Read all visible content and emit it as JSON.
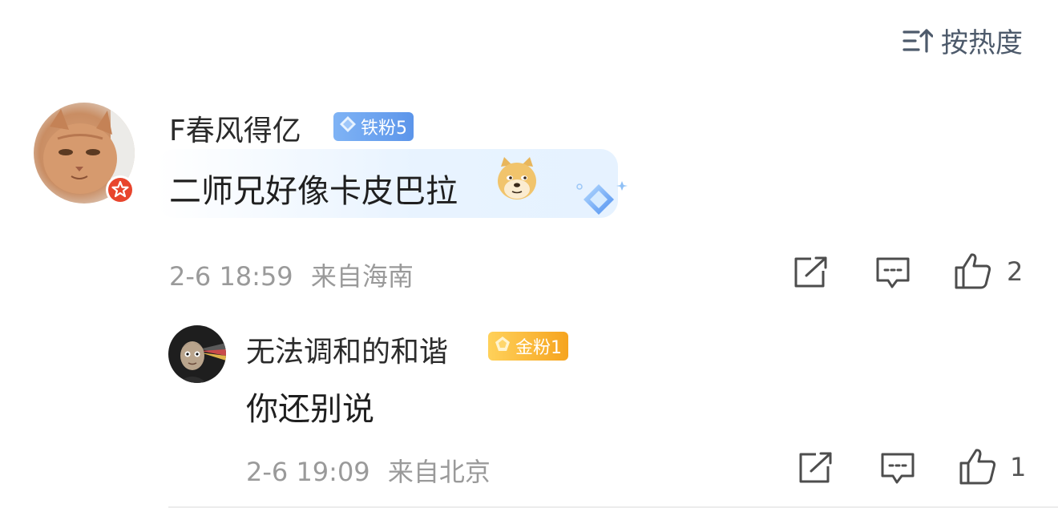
{
  "sort": {
    "label": "按热度",
    "icon": "sort-icon"
  },
  "comment": {
    "username": "F春风得亿",
    "fan_badge": "铁粉5",
    "fan_badge_icon": "diamond-icon",
    "text": "二师兄好像卡皮巴拉",
    "emoji": "doge-emoji",
    "time": "2-6 18:59",
    "location": "来自海南",
    "like_count": "2",
    "accent": "#5c95ea"
  },
  "reply": {
    "username": "无法调和的和谐",
    "fan_badge": "金粉1",
    "fan_badge_icon": "gold-gem-icon",
    "text": "你还别说",
    "time": "2-6 19:09",
    "location": "来自北京",
    "like_count": "1",
    "accent": "#f6a41f"
  }
}
